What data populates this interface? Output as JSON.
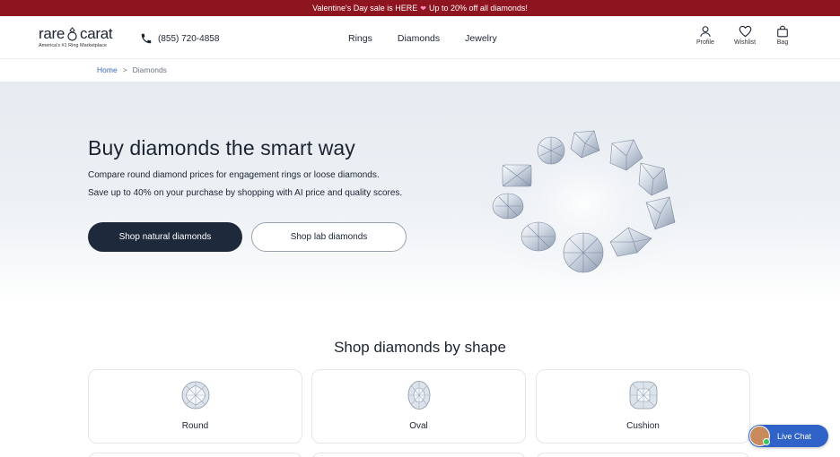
{
  "promo": {
    "text_before": "Valentine's Day sale is HERE",
    "heart_icon": "heart-icon",
    "text_after": "Up to 20% off all diamonds!"
  },
  "header": {
    "logo_word_1": "rare",
    "logo_word_2": "carat",
    "tagline": "America's #1 Ring Marketplace",
    "phone": "(855) 720-4858",
    "nav": [
      "Rings",
      "Diamonds",
      "Jewelry"
    ],
    "utilities": [
      {
        "label": "Profile",
        "icon": "person-icon"
      },
      {
        "label": "Wishlist",
        "icon": "heart-icon"
      },
      {
        "label": "Bag",
        "icon": "bag-icon"
      }
    ]
  },
  "breadcrumb": {
    "home": "Home",
    "separator": ">",
    "current": "Diamonds"
  },
  "hero": {
    "title": "Buy diamonds the smart way",
    "subtitle_1": "Compare round diamond prices for engagement rings or loose diamonds.",
    "subtitle_2": "Save up to 40% on your purchase by shopping with AI price and quality scores.",
    "btn_natural": "Shop natural diamonds",
    "btn_lab": "Shop lab diamonds"
  },
  "shapes": {
    "title": "Shop diamonds by shape",
    "items": [
      {
        "label": "Round",
        "icon": "round-diamond-icon"
      },
      {
        "label": "Oval",
        "icon": "oval-diamond-icon"
      },
      {
        "label": "Cushion",
        "icon": "cushion-diamond-icon"
      }
    ]
  },
  "chat": {
    "label": "Live Chat"
  },
  "colors": {
    "promo_bg": "#8e1420",
    "primary_dark": "#1e2a3b",
    "link_blue": "#3b6ab8",
    "chat_blue": "#2f63c7"
  }
}
